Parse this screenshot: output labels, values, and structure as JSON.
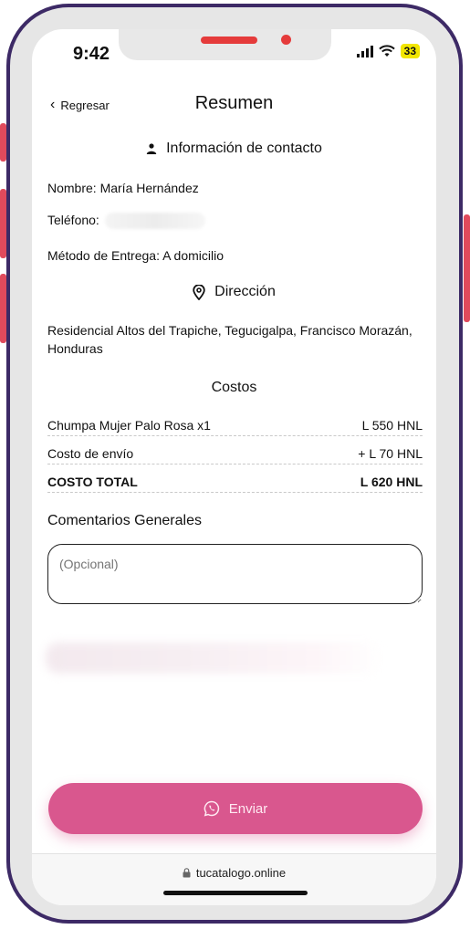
{
  "status_bar": {
    "time": "9:42",
    "battery": "33"
  },
  "nav": {
    "back_label": "Regresar",
    "title": "Resumen"
  },
  "contact": {
    "heading": "Información de contacto",
    "name_line": "Nombre: María Hernández",
    "phone_label": "Teléfono:",
    "delivery_line": "Método de Entrega: A domicilio"
  },
  "address": {
    "heading": "Dirección",
    "text": "Residencial Altos del Trapiche, Tegucigalpa, Francisco Morazán, Honduras"
  },
  "costs": {
    "heading": "Costos",
    "rows": [
      {
        "label": "Chumpa Mujer Palo Rosa x1",
        "value": "L 550 HNL"
      },
      {
        "label": "Costo de envío",
        "value": "+ L 70 HNL"
      },
      {
        "label": "COSTO TOTAL",
        "value": "L 620 HNL"
      }
    ]
  },
  "comments": {
    "label": "Comentarios Generales",
    "placeholder": "(Opcional)"
  },
  "send_button": {
    "label": "Enviar"
  },
  "browser": {
    "url": "tucatalogo.online"
  },
  "colors": {
    "accent": "#d9578e",
    "frame": "#3d2a66",
    "side_buttons": "#e04a5c"
  }
}
